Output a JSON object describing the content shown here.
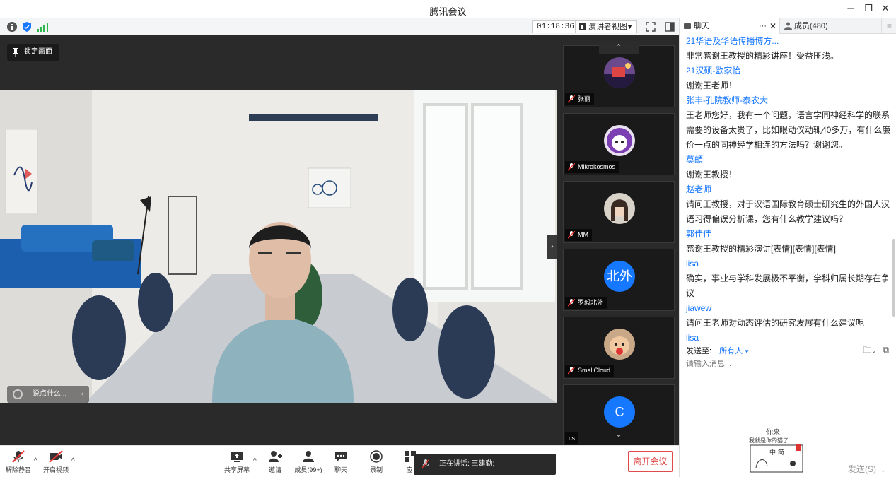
{
  "window": {
    "title": "腾讯会议"
  },
  "topbar": {
    "timer": "01:18:36",
    "view_label": "演讲者视图"
  },
  "stage": {
    "lock_label": "锁定画面",
    "chat_placeholder": "说点什么..."
  },
  "participants": [
    {
      "name": "张丽",
      "avatar": "photo"
    },
    {
      "name": "Mikrokosmos",
      "avatar": "photo"
    },
    {
      "name": "MM",
      "avatar": "photo"
    },
    {
      "name": "罗毅北外",
      "avatar_text": "北外"
    },
    {
      "name": "SmallCloud",
      "avatar": "photo"
    },
    {
      "name": "cs",
      "avatar_text": "C"
    }
  ],
  "bottombar": {
    "unmute": "解除静音",
    "start_video": "开启视频",
    "share_screen": "共享屏幕",
    "invite": "邀请",
    "members": "成员(99+)",
    "chat": "聊天",
    "record": "录制",
    "apps": "应",
    "speaking": "正在讲话: 王建勤;",
    "leave": "离开会议"
  },
  "panel": {
    "tab_chat": "聊天",
    "tab_members": "成员(480)",
    "messages": [
      {
        "type": "sender",
        "text": "21华语及华语传播博方..."
      },
      {
        "type": "text",
        "text": "非常感谢王教授的精彩讲座！受益匪浅。"
      },
      {
        "type": "sender",
        "text": "21汉硕-欧家怡"
      },
      {
        "type": "text",
        "text": "谢谢王老师！"
      },
      {
        "type": "sender",
        "text": "张丰-孔院教师-泰农大"
      },
      {
        "type": "text",
        "text": "王老师您好，我有一个问题，语言学同神经科学的联系"
      },
      {
        "type": "text",
        "text": "需要的设备太贵了，比如眼动仪动辄40多万，有什么廉"
      },
      {
        "type": "text",
        "text": "价一点的同神经学相连的方法吗？谢谢您。"
      },
      {
        "type": "sender",
        "text": "莫頔"
      },
      {
        "type": "text",
        "text": "谢谢王教授！"
      },
      {
        "type": "sender",
        "text": "赵老师"
      },
      {
        "type": "text",
        "text": "请问王教授，对于汉语国际教育硕士研究生的外国人汉"
      },
      {
        "type": "text",
        "text": "语习得偏误分析课，您有什么教学建议吗？"
      },
      {
        "type": "sender",
        "text": "郭佳佳"
      },
      {
        "type": "text",
        "text": "感谢王教授的精彩演讲[表情][表情][表情]"
      },
      {
        "type": "sender",
        "text": "lisa"
      },
      {
        "type": "text",
        "text": "确实，事业与学科发展极不平衡，学科归属长期存在争"
      },
      {
        "type": "text",
        "text": "议"
      },
      {
        "type": "sender",
        "text": "jiawew"
      },
      {
        "type": "text",
        "text": "请问王老师对动态评估的研究发展有什么建议呢"
      },
      {
        "type": "sender",
        "text": "lisa"
      }
    ],
    "send_to_label": "发送至:",
    "send_to_target": "所有人",
    "input_placeholder": "请输入消息...",
    "send_button": "发送(S)",
    "sticker_text_top": "你来",
    "sticker_text_mid": "我就是你的猫了",
    "sticker_text_sign": "中 简"
  },
  "colors": {
    "accent": "#1677ff",
    "leave": "#e04a4a",
    "stage": "#2a2a2a"
  }
}
